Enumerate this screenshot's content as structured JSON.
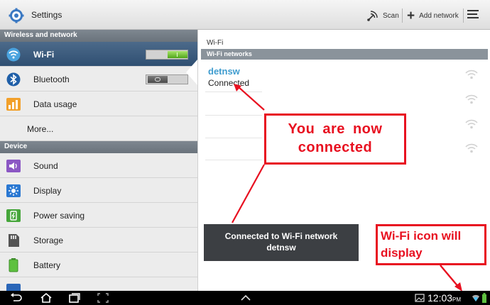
{
  "header": {
    "title": "Settings",
    "scan_label": "Scan",
    "add_network_label": "Add network"
  },
  "sidebar": {
    "sections": [
      {
        "header": "Wireless and network"
      },
      {
        "header": "Device"
      }
    ],
    "items": [
      {
        "label": "Wi-Fi",
        "icon": "wifi-icon",
        "toggle": "on",
        "active": true
      },
      {
        "label": "Bluetooth",
        "icon": "bluetooth-icon",
        "toggle": "off"
      },
      {
        "label": "Data usage",
        "icon": "data-usage-icon"
      },
      {
        "label": "More..."
      },
      {
        "label": "Sound",
        "icon": "sound-icon"
      },
      {
        "label": "Display",
        "icon": "display-icon"
      },
      {
        "label": "Power saving",
        "icon": "power-saving-icon"
      },
      {
        "label": "Storage",
        "icon": "storage-icon"
      },
      {
        "label": "Battery",
        "icon": "battery-icon"
      }
    ]
  },
  "main": {
    "title": "Wi-Fi",
    "section_header": "Wi-Fi networks",
    "network": {
      "name": "detnsw",
      "status": "Connected"
    }
  },
  "toast": {
    "line1": "Connected to Wi-Fi network",
    "line2": "detnsw"
  },
  "annotations": {
    "connected_line1": "You are now",
    "connected_line2": "connected",
    "icon_line1": "Wi-Fi icon will",
    "icon_line2": "display"
  },
  "statusbar": {
    "time": "12:03",
    "ampm": "PM"
  },
  "colors": {
    "annotation": "#e81020",
    "network_name": "#3f9ccf",
    "active_item": "#2f4f72",
    "toggle_on": "#4fa519"
  }
}
